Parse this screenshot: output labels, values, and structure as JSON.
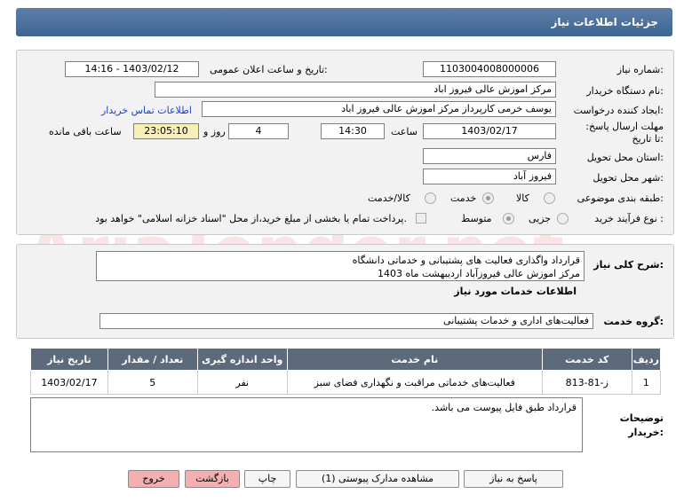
{
  "header": {
    "title": "جزئیات اطلاعات نیاز"
  },
  "form": {
    "need_number_label": "شماره نیاز:",
    "need_number": "1103004008000006",
    "announce_label": "تاریخ و ساعت اعلان عمومی:",
    "announce_value": "1403/02/12 - 14:16",
    "buyer_label": "نام دستگاه خریدار:",
    "buyer_value": "مرکز اموزش عالی فیروز اباد",
    "creator_label": "ایجاد کننده درخواست:",
    "creator_value": "یوسف خرمی کارپرداز مرکز اموزش عالی فیروز اباد",
    "contact_link": "اطلاعات تماس خریدار",
    "deadline_label": "مهلت ارسال پاسخ: تا تاریخ:",
    "deadline_date": "1403/02/17",
    "time_label": "ساعت",
    "deadline_time": "14:30",
    "days_value": "4",
    "days_label": "روز و",
    "remaining_value": "23:05:10",
    "remaining_label": "ساعت باقی مانده",
    "province_label": "استان محل تحویل:",
    "province_value": "فارس",
    "city_label": "شهر محل تحویل:",
    "city_value": "فیروز آباد",
    "category_label": "طبقه بندی موضوعی:",
    "category_options": [
      "کالا",
      "خدمت",
      "کالا/خدمت"
    ],
    "category_selected": "خدمت",
    "process_label": "نوع فرآیند خرید :",
    "process_options": [
      "جزیی",
      "متوسط"
    ],
    "process_selected": "متوسط",
    "payment_note": "پرداخت تمام یا بخشی از مبلغ خرید،از محل \"اسناد خزانه اسلامی\" خواهد بود."
  },
  "description": {
    "label": "شرح کلی نیاز:",
    "line1": "قرارداد واگذاری فعالیت های پشتیبانی و خدماتی دانشگاه",
    "line2": "مرکز اموزش عالی فیروزآباد  اردیبهشت  ماه 1403"
  },
  "services": {
    "section_title": "اطلاعات خدمات مورد نیاز",
    "group_label": "گروه خدمت:",
    "group_value": "فعالیت‌های اداری و خدمات پشتیبانی"
  },
  "table": {
    "columns": [
      "ردیف",
      "کد خدمت",
      "نام خدمت",
      "واحد اندازه گیری",
      "تعداد / مقدار",
      "تاریخ نیاز"
    ],
    "rows": [
      [
        "1",
        "ز-81-813",
        "فعالیت‌های خدماتی مراقبت و نگهداری فضای سبز",
        "نفر",
        "5",
        "1403/02/17"
      ]
    ]
  },
  "notes": {
    "label": "توضیحات خریدار:",
    "value": "قرارداد طبق فایل پیوست می باشد."
  },
  "buttons": {
    "reply": "پاسخ به نیاز",
    "attachments": "مشاهده مدارک پیوستی (1)",
    "print": "چاپ",
    "back": "بازگشت",
    "exit": "خروج"
  },
  "watermark": "AriaTender.net",
  "colors": {
    "header": "#4a6f9c",
    "link": "#1a3fcc",
    "remaining_bg": "#f6efb8",
    "exit_bg": "#f4b0b0"
  }
}
